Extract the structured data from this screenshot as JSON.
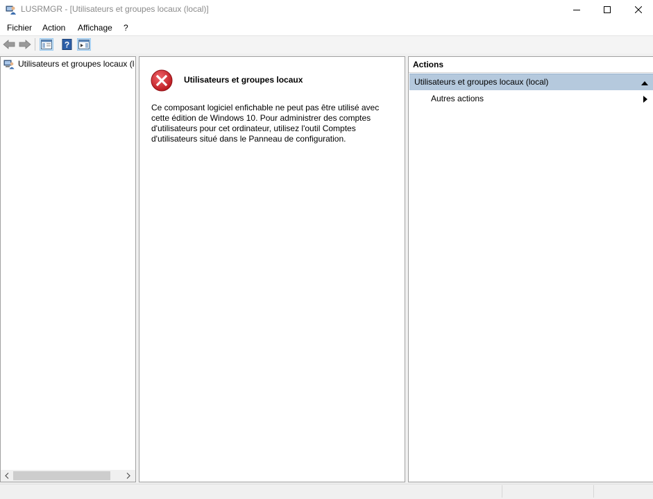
{
  "window": {
    "title": "LUSRMGR - [Utilisateurs et groupes locaux (local)]"
  },
  "menu": {
    "items": [
      "Fichier",
      "Action",
      "Affichage",
      "?"
    ]
  },
  "toolbar": {
    "buttons": [
      "back-arrow-icon",
      "forward-arrow-icon",
      "show-hide-console-tree-icon",
      "help-icon",
      "show-hide-action-pane-icon"
    ]
  },
  "tree": {
    "root_label": "Utilisateurs et groupes locaux (local)"
  },
  "center": {
    "title": "Utilisateurs et groupes locaux",
    "message": "Ce composant logiciel enfichable ne peut pas être utilisé avec cette édition de Windows 10. Pour administrer des comptes d'utilisateurs pour cet ordinateur, utilisez l'outil Comptes d'utilisateurs situé dans le Panneau de configuration."
  },
  "actions": {
    "title": "Actions",
    "section_label": "Utilisateurs et groupes locaux (local)",
    "more_actions_label": "Autres actions"
  },
  "colors": {
    "accent_section": "#b5c9dd",
    "error_red": "#d9262b"
  }
}
